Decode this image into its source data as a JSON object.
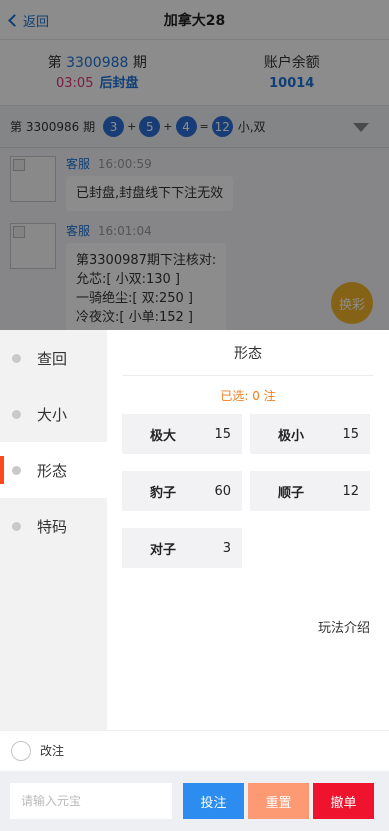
{
  "nav": {
    "back_label": "返回",
    "title": "加拿大28"
  },
  "issue": {
    "prefix": "第",
    "number": "3300988",
    "suffix": "期",
    "countdown": "03:05",
    "status": "后封盘",
    "balance_label": "账户余额",
    "balance_value": "10014"
  },
  "last_result": {
    "label": "第 3300986 期",
    "balls": [
      "3",
      "5",
      "4"
    ],
    "sum": "12",
    "plus": "+",
    "equals": "=",
    "text": "小,双"
  },
  "chat": {
    "messages": [
      {
        "sender": "客服",
        "time": "16:00:59",
        "lines": [
          "已封盘,封盘线下下注无效"
        ]
      },
      {
        "sender": "客服",
        "time": "16:01:04",
        "lines": [
          "第3300987期下注核对:",
          "允芯:[ 小双:130 ]",
          "一骑绝尘:[ 双:250 ]",
          "冷夜汶:[ 小单:152 ]"
        ]
      }
    ]
  },
  "float_button": {
    "label": "换彩"
  },
  "sidebar": {
    "items": [
      {
        "label": "查回",
        "active": false
      },
      {
        "label": "大小",
        "active": false
      },
      {
        "label": "形态",
        "active": true
      },
      {
        "label": "特码",
        "active": false
      }
    ]
  },
  "panel": {
    "title": "形态",
    "selected_text": "已选: 0 注",
    "options": [
      {
        "name": "极大",
        "odds": "15"
      },
      {
        "name": "极小",
        "odds": "15"
      },
      {
        "name": "豹子",
        "odds": "60"
      },
      {
        "name": "顺子",
        "odds": "12"
      },
      {
        "name": "对子",
        "odds": "3"
      }
    ],
    "intro_label": "玩法介绍"
  },
  "chase": {
    "label": "改注"
  },
  "footer": {
    "amount_placeholder": "请输入元宝",
    "bet_label": "投注",
    "reset_label": "重置",
    "cancel_label": "撤单"
  },
  "colors": {
    "accent": "#2d8cf0",
    "active_marker": "#ff4a1e",
    "selected_text": "#f07d1f",
    "reset": "#fd9a74",
    "cancel": "#f0132e",
    "ball": "#2d6fd8",
    "float_button": "#f0b429"
  }
}
